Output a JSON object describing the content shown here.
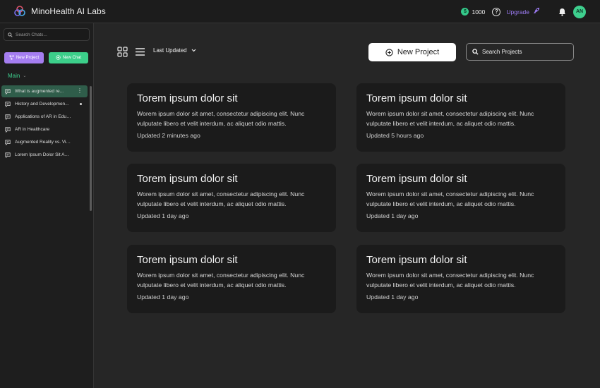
{
  "app": {
    "name": "MinoHealth AI Labs",
    "credits": "1000",
    "upgrade_label": "Upgrade",
    "avatar_initials": "AN"
  },
  "sidebar": {
    "search_placeholder": "Search Chats...",
    "new_project_label": "New Project",
    "new_chat_label": "New Chat",
    "section_label": "Main",
    "chats": [
      {
        "label": "What is augmented re..."
      },
      {
        "label": "History and Developmen..."
      },
      {
        "label": "Applications of AR in Educa..."
      },
      {
        "label": "AR in Healthcare"
      },
      {
        "label": "Augmented Reality vs. Virtu..."
      },
      {
        "label": "Lorem Ipsum Dolor Sit Amet"
      }
    ]
  },
  "toolbar": {
    "sort_label": "Last Updated",
    "new_project_label": "New Project",
    "search_placeholder": "Search Projects"
  },
  "projects": [
    {
      "title": "Torem ipsum dolor sit",
      "desc1": "Worem ipsum dolor sit amet, consectetur adipiscing elit. Nunc",
      "desc2": "vulputate libero et velit interdum, ac aliquet odio mattis.",
      "updated": "Updated 2 minutes ago"
    },
    {
      "title": "Torem ipsum dolor sit",
      "desc1": "Worem ipsum dolor sit amet, consectetur adipiscing elit. Nunc",
      "desc2": "vulputate libero et velit interdum, ac aliquet odio mattis.",
      "updated": "Updated 5 hours ago"
    },
    {
      "title": "Torem ipsum dolor sit",
      "desc1": "Worem ipsum dolor sit amet, consectetur adipiscing elit. Nunc",
      "desc2": "vulputate libero et velit interdum, ac aliquet odio mattis.",
      "updated": "Updated 1 day ago"
    },
    {
      "title": "Torem ipsum dolor sit",
      "desc1": "Worem ipsum dolor sit amet, consectetur adipiscing elit. Nunc",
      "desc2": "vulputate libero et velit interdum, ac aliquet odio mattis.",
      "updated": "Updated 1 day ago"
    },
    {
      "title": "Torem ipsum dolor sit",
      "desc1": "Worem ipsum dolor sit amet, consectetur adipiscing elit. Nunc",
      "desc2": "vulputate libero et velit interdum, ac aliquet odio mattis.",
      "updated": "Updated 1 day ago"
    },
    {
      "title": "Torem ipsum dolor sit",
      "desc1": "Worem ipsum dolor sit amet, consectetur adipiscing elit. Nunc",
      "desc2": "vulputate libero et velit interdum, ac aliquet odio mattis.",
      "updated": "Updated 1 day ago"
    }
  ],
  "colors": {
    "accent_green": "#3ecf8e",
    "accent_purple": "#a57ef0",
    "background": "#262626",
    "card": "#1b1b1b"
  }
}
